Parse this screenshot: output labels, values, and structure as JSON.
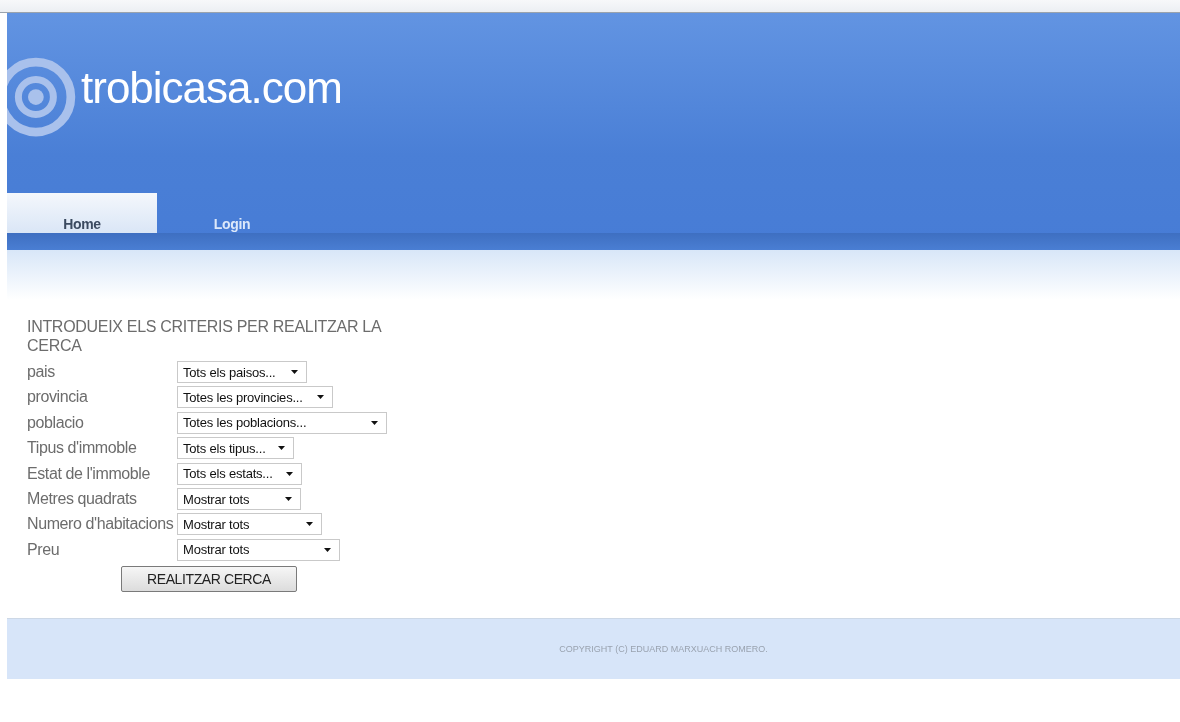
{
  "site": {
    "logo_text": "trobicasa.com"
  },
  "nav": [
    {
      "label": "Home",
      "selected": true
    },
    {
      "label": "Login",
      "selected": false
    }
  ],
  "search_form": {
    "heading": "INTRODUEIX ELS CRITERIS PER REALITZAR LA CERCA",
    "fields": [
      {
        "label": "pais",
        "value": "Tots els paisos..."
      },
      {
        "label": "provincia",
        "value": "Totes les provincies..."
      },
      {
        "label": "poblacio",
        "value": "Totes les poblacions..."
      },
      {
        "label": "Tipus d'immoble",
        "value": "Tots els tipus..."
      },
      {
        "label": "Estat de l'immoble",
        "value": "Tots els estats..."
      },
      {
        "label": "Metres quadrats",
        "value": "Mostrar tots"
      },
      {
        "label": "Numero d'habitacions",
        "value": "Mostrar tots"
      },
      {
        "label": "Preu",
        "value": "Mostrar tots"
      }
    ],
    "submit": "REALITZAR CERCA"
  },
  "footer": {
    "copyright": "COPYRIGHT (C) EDUARD MARXUACH ROMERO."
  }
}
